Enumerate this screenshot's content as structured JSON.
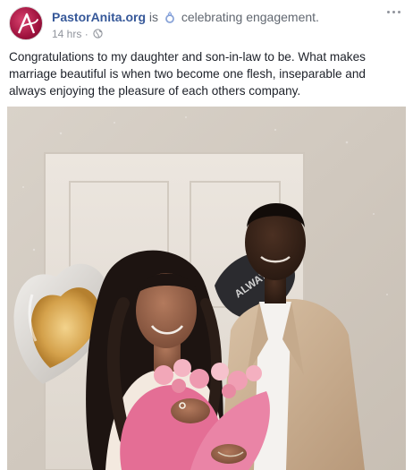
{
  "post": {
    "page_name": "PastorAnita.org",
    "is_word": "is",
    "activity_icon": "ring-icon",
    "activity_text": "celebrating engagement.",
    "timestamp": "14 hrs",
    "separator": "·",
    "audience_icon": "globe-icon",
    "more_icon": "more-options-icon",
    "text": "Congratulations to my daughter and son-in-law to be. What makes marriage beautiful is when two become one flesh, inseparable and always enjoying the pleasure of each others company.",
    "photo_balloon_text": "ALWAYS"
  },
  "colors": {
    "link_blue": "#365899",
    "meta_gray": "#90949c",
    "text_dark": "#1d2129",
    "avatar_brand": "#b0154a"
  }
}
